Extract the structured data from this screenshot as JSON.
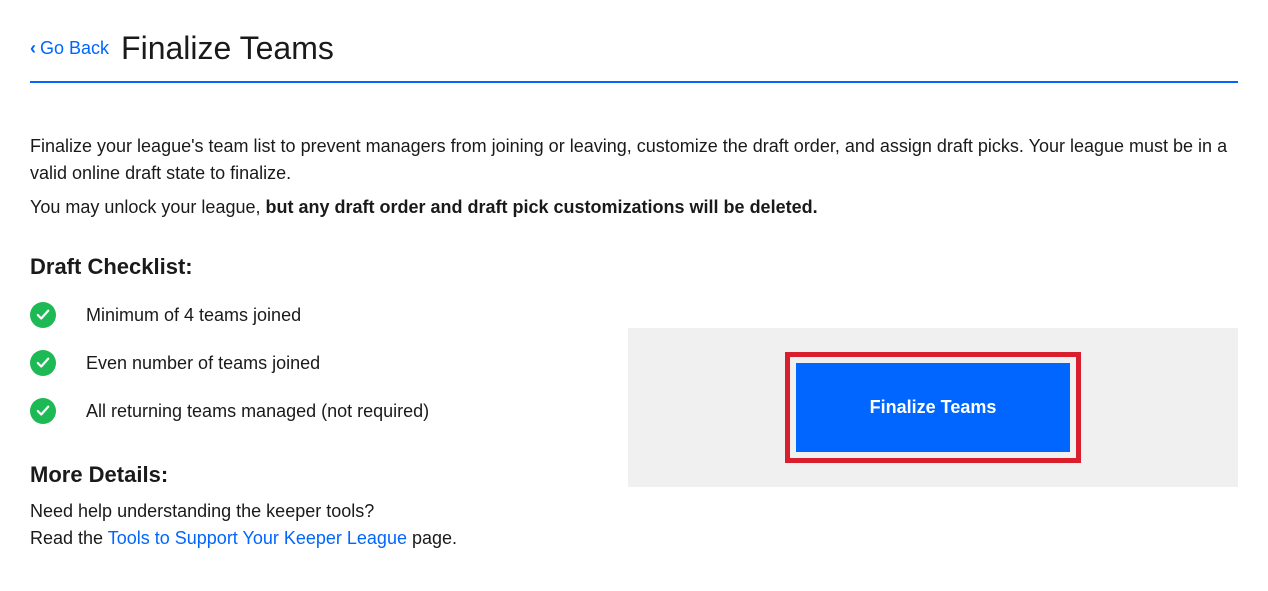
{
  "header": {
    "go_back_label": "Go Back",
    "page_title": "Finalize Teams"
  },
  "intro": {
    "paragraph1": "Finalize your league's team list to prevent managers from joining or leaving, customize the draft order, and assign draft picks. Your league must be in a valid online draft state to finalize.",
    "paragraph2_prefix": "You may unlock your league, ",
    "paragraph2_bold": "but any draft order and draft pick customizations will be deleted."
  },
  "checklist": {
    "heading": "Draft Checklist:",
    "items": [
      {
        "label": "Minimum of 4 teams joined"
      },
      {
        "label": "Even number of teams joined"
      },
      {
        "label": "All returning teams managed (not required)"
      }
    ]
  },
  "more_details": {
    "heading": "More Details:",
    "help_question": "Need help understanding the keeper tools?",
    "help_prefix": "Read the ",
    "help_link_label": "Tools to Support Your Keeper League",
    "help_suffix": " page."
  },
  "action": {
    "finalize_button_label": "Finalize Teams"
  }
}
